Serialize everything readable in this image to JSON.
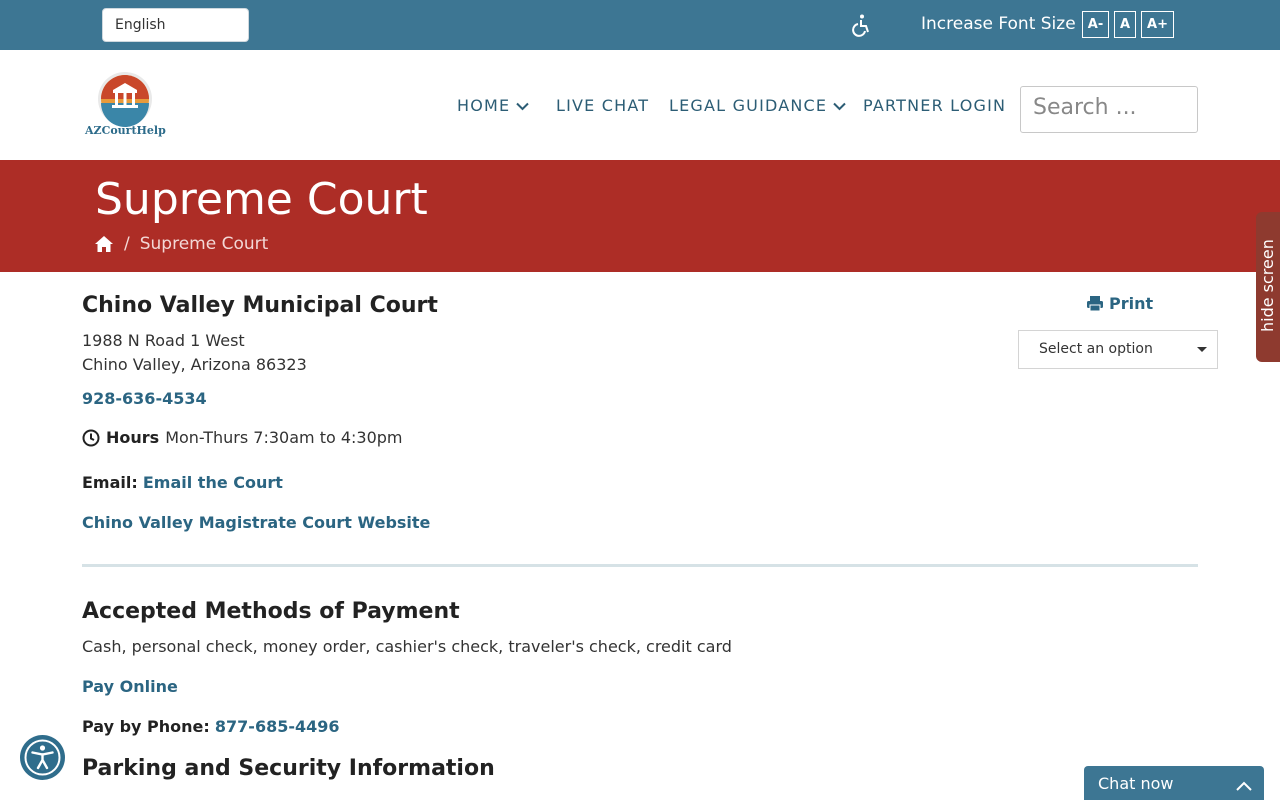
{
  "topbar": {
    "language": "English",
    "font_size_label": "Increase Font Size",
    "font_buttons": [
      "A-",
      "A",
      "A+"
    ]
  },
  "header": {
    "logo_text": "AZCourtHelp",
    "nav": [
      "HOME",
      "LIVE CHAT",
      "LEGAL GUIDANCE",
      "PARTNER LOGIN"
    ],
    "search_placeholder": "Search ..."
  },
  "banner": {
    "title": "Supreme Court",
    "breadcrumb_current": "Supreme Court"
  },
  "side_tab": {
    "label": "hide screen"
  },
  "court": {
    "name": "Chino Valley Municipal Court",
    "address_line1": "1988 N Road 1 West",
    "address_line2": "Chino Valley, Arizona 86323",
    "phone": "928-636-4534",
    "hours_label": "Hours",
    "hours_value": "Mon-Thurs 7:30am to 4:30pm",
    "email_label": "Email:",
    "email_link": "Email the Court",
    "website_link": "Chino Valley Magistrate Court Website"
  },
  "actions": {
    "print_label": "Print",
    "select_placeholder": "Select an option"
  },
  "payment": {
    "title": "Accepted Methods of Payment",
    "methods": "Cash, personal check, money order, cashier's check, traveler's check, credit card",
    "pay_online": "Pay Online",
    "pay_phone_label": "Pay by Phone:",
    "pay_phone_number": "877-685-4496"
  },
  "parking": {
    "title": "Parking and Security Information"
  },
  "chat": {
    "label": "Chat now"
  },
  "colors": {
    "topbar": "#3d7693",
    "banner": "#ad2d26",
    "link": "#2b6582"
  }
}
